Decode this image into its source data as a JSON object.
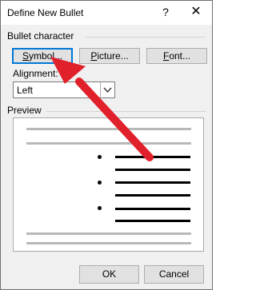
{
  "window": {
    "title": "Define New Bullet",
    "help_glyph": "?",
    "close_glyph": "✕"
  },
  "bullet_character": {
    "label": "Bullet character",
    "symbol_button": {
      "first": "S",
      "rest": "ymbol..."
    },
    "picture_button": {
      "first": "P",
      "rest": "icture..."
    },
    "font_button": {
      "first": "F",
      "rest": "ont..."
    }
  },
  "alignment": {
    "label_first": "Alignment",
    "label_rest": ":",
    "value": "Left"
  },
  "preview": {
    "label": "Preview",
    "bullet_count": 3
  },
  "footer": {
    "ok_label": "OK",
    "cancel_label": "Cancel"
  },
  "annotation": {
    "arrow_color": "#e0202a"
  },
  "colors": {
    "dialog_bg": "#f0f0f0",
    "focus_border": "#0078d7",
    "preview_grey": "#b8b8b8"
  },
  "icons": {
    "help": "help-icon",
    "close": "close-icon",
    "dropdown": "chevron-down-icon",
    "arrow": "red-arrow-annotation"
  }
}
